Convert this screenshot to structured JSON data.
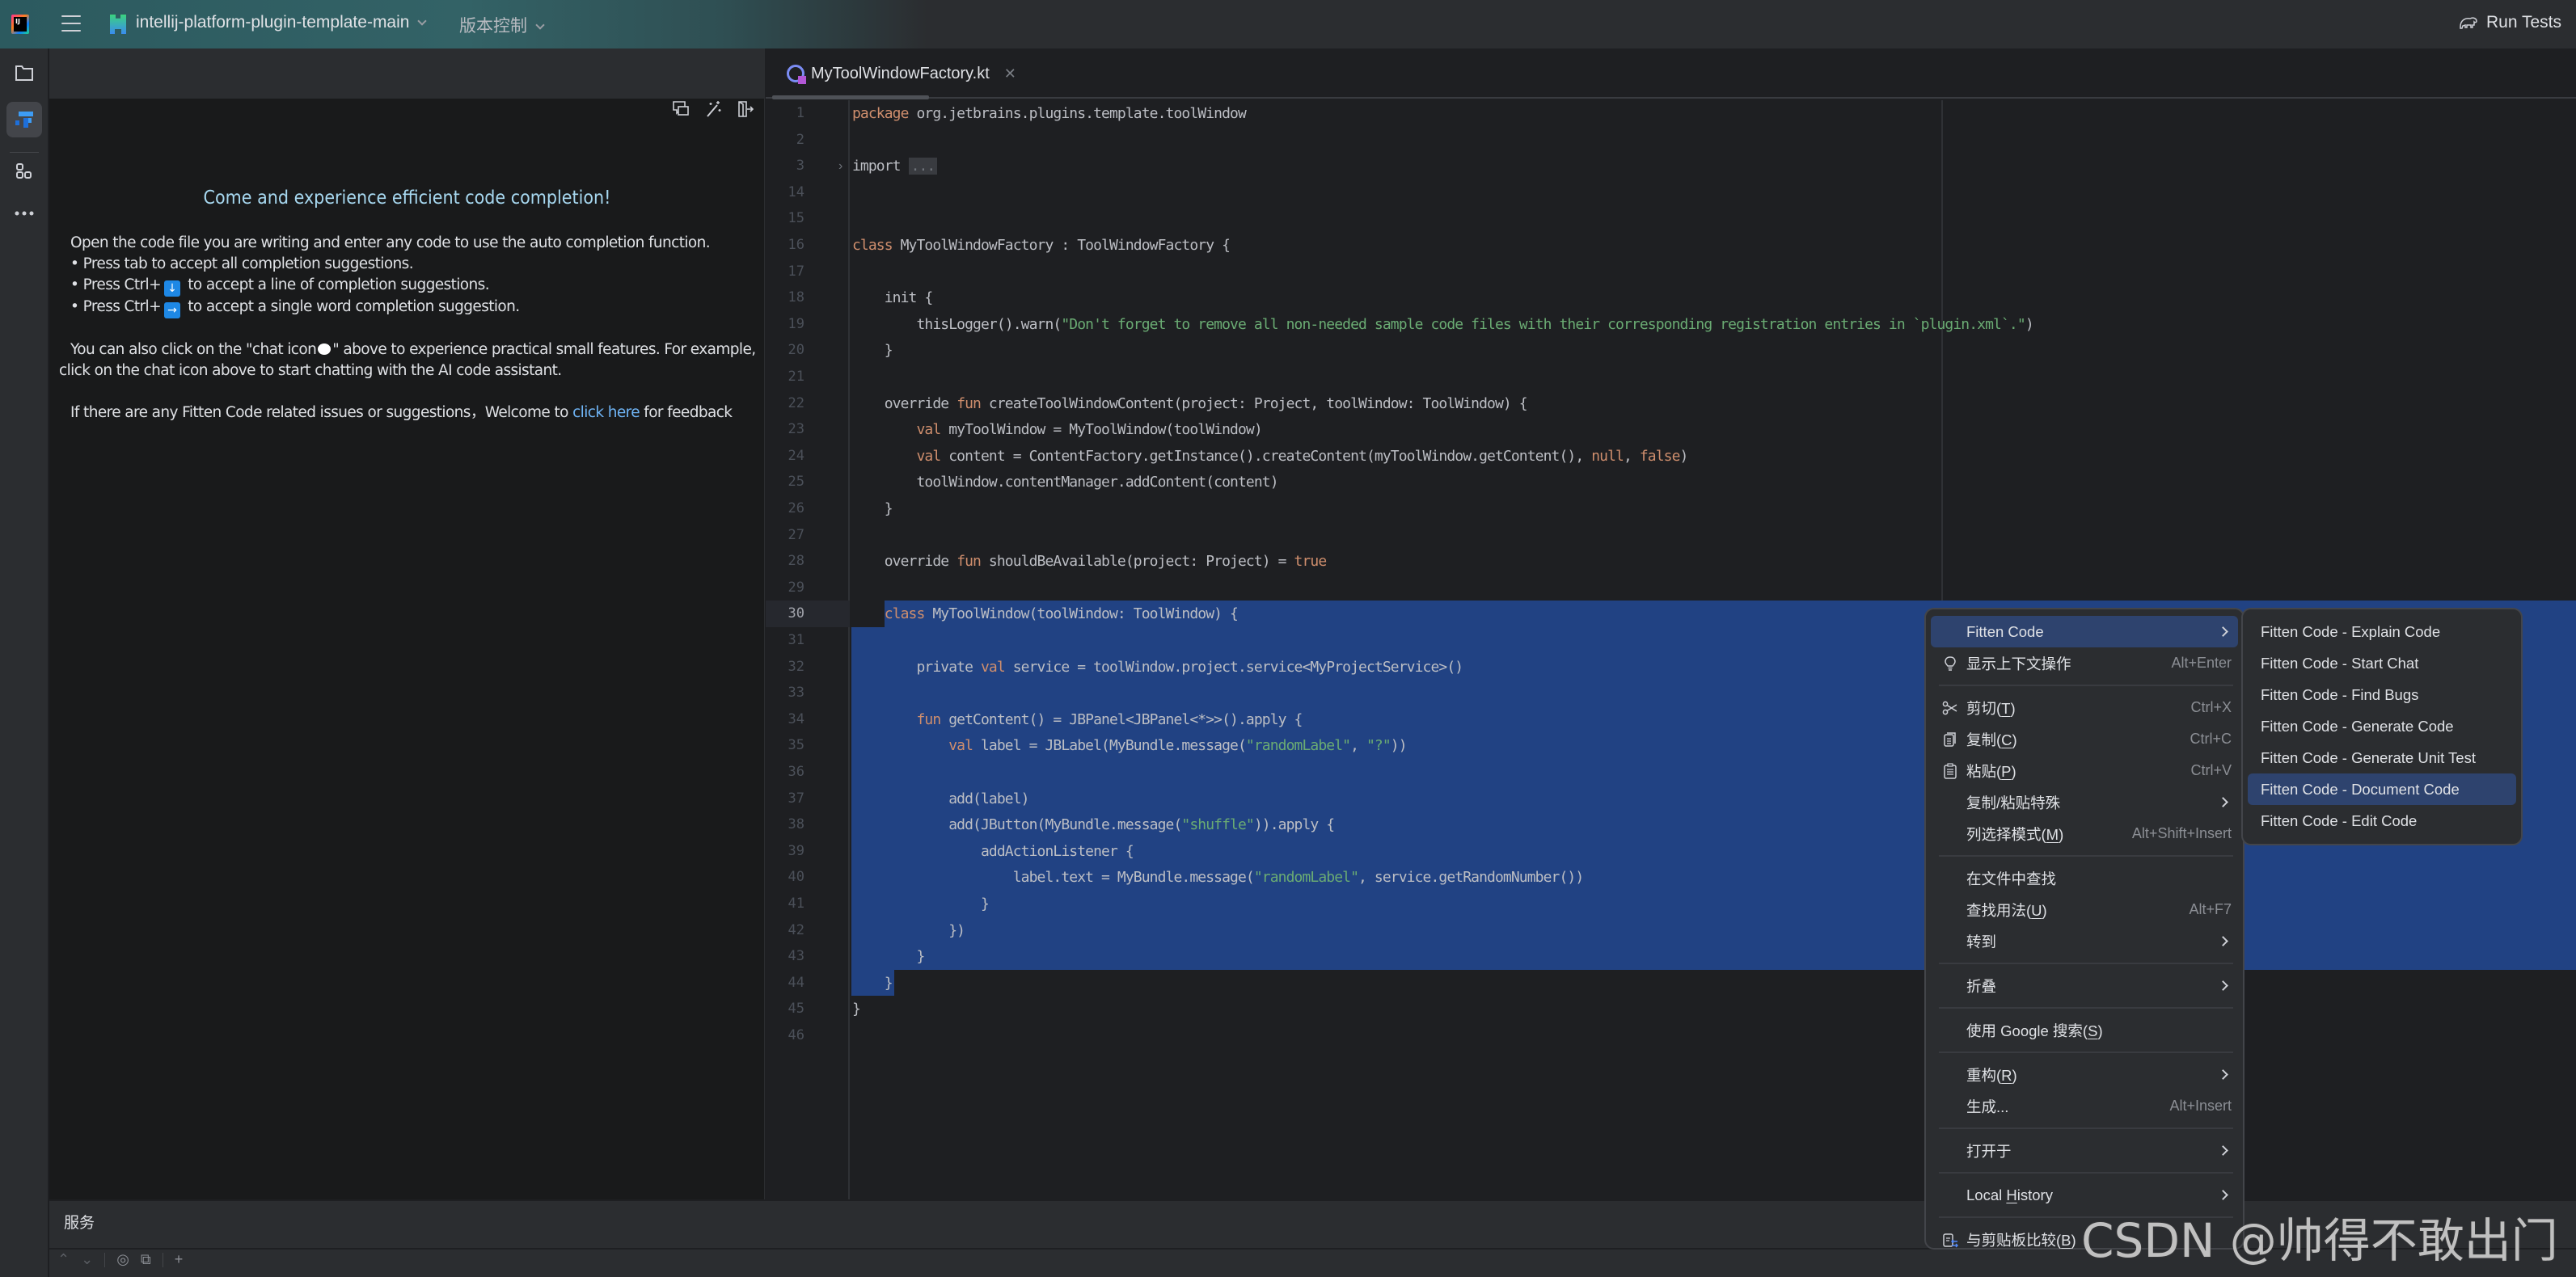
{
  "titlebar": {
    "project_name": "intellij-platform-plugin-template-main",
    "vcs_label": "版本控制",
    "run_label": "Run Tests"
  },
  "toolstrip": {
    "items": [
      "project-icon",
      "fitten-code-icon",
      "structure-icon",
      "more-icon"
    ]
  },
  "fitten": {
    "title": "Come and experience efficient code completion!",
    "intro": "Open the code file you are writing and enter any code to use the auto completion function.",
    "bullet1": "• Press tab to accept all completion suggestions.",
    "bullet2_pre": "• Press Ctrl+",
    "bullet2_key": "↓",
    "bullet2_post": " to accept a line of completion suggestions.",
    "bullet3_pre": "• Press Ctrl+",
    "bullet3_key": "→",
    "bullet3_post": " to accept a single word completion suggestion.",
    "chat_pre": "You can also click on the \"chat icon",
    "chat_post": "\" above to experience practical small features. For example, click on the chat icon above to start chatting with the AI code assistant.",
    "feedback_pre": "If there are any Fitten Code related issues or suggestions，Welcome to ",
    "feedback_link": "click here",
    "feedback_post": " for feedback"
  },
  "editor": {
    "tab_label": "MyToolWindowFactory.kt",
    "current_line": 30,
    "lines": [
      {
        "n": "1",
        "html": "<span class='kw'>package</span> org.jetbrains.plugins.template.toolWindow"
      },
      {
        "n": "2",
        "html": ""
      },
      {
        "n": "3",
        "html": "import <span class='fold'>...</span>",
        "fold": true
      },
      {
        "n": "14",
        "html": ""
      },
      {
        "n": "15",
        "html": ""
      },
      {
        "n": "16",
        "html": "<span class='kw'>class</span> MyToolWindowFactory : ToolWindowFactory {"
      },
      {
        "n": "17",
        "html": ""
      },
      {
        "n": "18",
        "html": "    init {"
      },
      {
        "n": "19",
        "html": "        thisLogger().warn(<span class='str'>\"Don't forget to remove all non-needed sample code files with their corresponding registration entries in `plugin.xml`.\"</span>)"
      },
      {
        "n": "20",
        "html": "    }"
      },
      {
        "n": "21",
        "html": ""
      },
      {
        "n": "22",
        "html": "    override <span class='kw'>fun</span> createToolWindowContent(project: Project, toolWindow: ToolWindow) {"
      },
      {
        "n": "23",
        "html": "        <span class='kw'>val</span> myToolWindow = MyToolWindow(toolWindow)"
      },
      {
        "n": "24",
        "html": "        <span class='kw'>val</span> content = ContentFactory.getInstance().createContent(myToolWindow.getContent(), <span class='kw'>null</span>, <span class='kw'>false</span>)"
      },
      {
        "n": "25",
        "html": "        toolWindow.contentManager.addContent(content)"
      },
      {
        "n": "26",
        "html": "    }"
      },
      {
        "n": "27",
        "html": ""
      },
      {
        "n": "28",
        "html": "    override <span class='kw'>fun</span> shouldBeAvailable(project: Project) = <span class='kw'>true</span>"
      },
      {
        "n": "29",
        "html": ""
      },
      {
        "n": "30",
        "html": "    <span class='kw'>class</span> MyToolWindow(toolWindow: ToolWindow) {"
      },
      {
        "n": "31",
        "html": ""
      },
      {
        "n": "32",
        "html": "        private <span class='kw'>val</span> service = toolWindow.project.service&lt;MyProjectService&gt;()"
      },
      {
        "n": "33",
        "html": ""
      },
      {
        "n": "34",
        "html": "        <span class='kw'>fun</span> getContent() = JBPanel&lt;JBPanel&lt;*&gt;&gt;().apply {"
      },
      {
        "n": "35",
        "html": "            <span class='kw'>val</span> label = JBLabel(MyBundle.message(<span class='str'>\"randomLabel\"</span>, <span class='str'>\"?\"</span>))"
      },
      {
        "n": "36",
        "html": ""
      },
      {
        "n": "37",
        "html": "            add(label)"
      },
      {
        "n": "38",
        "html": "            add(JButton(MyBundle.message(<span class='str'>\"shuffle\"</span>)).apply {"
      },
      {
        "n": "39",
        "html": "                addActionListener {"
      },
      {
        "n": "40",
        "html": "                    label.text = MyBundle.message(<span class='str'>\"randomLabel\"</span>, service.getRandomNumber())"
      },
      {
        "n": "41",
        "html": "                }"
      },
      {
        "n": "42",
        "html": "            })"
      },
      {
        "n": "43",
        "html": "        }"
      },
      {
        "n": "44",
        "html": "    }"
      },
      {
        "n": "45",
        "html": "}"
      },
      {
        "n": "46",
        "html": ""
      }
    ]
  },
  "bottom": {
    "title": "服务"
  },
  "context_menu": {
    "items": [
      {
        "type": "item",
        "label": "Fitten Code",
        "submenu": true,
        "highlighted": true
      },
      {
        "type": "item",
        "icon": "lightbulb-icon",
        "label": "显示上下文操作",
        "shortcut": "Alt+Enter"
      },
      {
        "type": "sep"
      },
      {
        "type": "item",
        "icon": "scissors-icon",
        "label": "剪切(<u>T</u>)",
        "shortcut": "Ctrl+X"
      },
      {
        "type": "item",
        "icon": "copy-icon",
        "label": "复制(<u>C</u>)",
        "shortcut": "Ctrl+C"
      },
      {
        "type": "item",
        "icon": "paste-icon",
        "label": "粘贴(<u>P</u>)",
        "shortcut": "Ctrl+V"
      },
      {
        "type": "item",
        "label": "复制/粘贴特殊",
        "submenu": true
      },
      {
        "type": "item",
        "label": "列选择模式(<u>M</u>)",
        "shortcut": "Alt+Shift+Insert"
      },
      {
        "type": "sep"
      },
      {
        "type": "item",
        "label": "在文件中查找"
      },
      {
        "type": "item",
        "label": "查找用法(<u>U</u>)",
        "shortcut": "Alt+F7"
      },
      {
        "type": "item",
        "label": "转到",
        "submenu": true
      },
      {
        "type": "sep"
      },
      {
        "type": "item",
        "label": "折叠",
        "submenu": true
      },
      {
        "type": "sep"
      },
      {
        "type": "item",
        "label": "使用 Google 搜索(<u>S</u>)"
      },
      {
        "type": "sep"
      },
      {
        "type": "item",
        "label": "重构(<u>R</u>)",
        "submenu": true
      },
      {
        "type": "item",
        "label": "生成...",
        "shortcut": "Alt+Insert"
      },
      {
        "type": "sep"
      },
      {
        "type": "item",
        "label": "打开于",
        "submenu": true
      },
      {
        "type": "sep"
      },
      {
        "type": "item",
        "label": "Local <u>H</u>istory",
        "submenu": true
      },
      {
        "type": "sep"
      },
      {
        "type": "item",
        "icon": "compare-clipboard-icon",
        "label": "与剪贴板比较(<u>B</u>)"
      }
    ]
  },
  "submenu": {
    "items": [
      {
        "label": "Fitten Code - Explain Code"
      },
      {
        "label": "Fitten Code - Start Chat"
      },
      {
        "label": "Fitten Code - Find Bugs"
      },
      {
        "label": "Fitten Code - Generate Code"
      },
      {
        "label": "Fitten Code - Generate Unit Test"
      },
      {
        "label": "Fitten Code - Document Code",
        "highlighted": true
      },
      {
        "label": "Fitten Code - Edit Code"
      }
    ]
  },
  "watermark": "CSDN @帅得不敢出门",
  "colors": {
    "selection": "#214283",
    "keyword": "#cf8e6d",
    "string": "#6aab73",
    "menu_highlight": "#2e436e",
    "fitten_title": "#a7d8f0",
    "link": "#6fb4f5"
  }
}
